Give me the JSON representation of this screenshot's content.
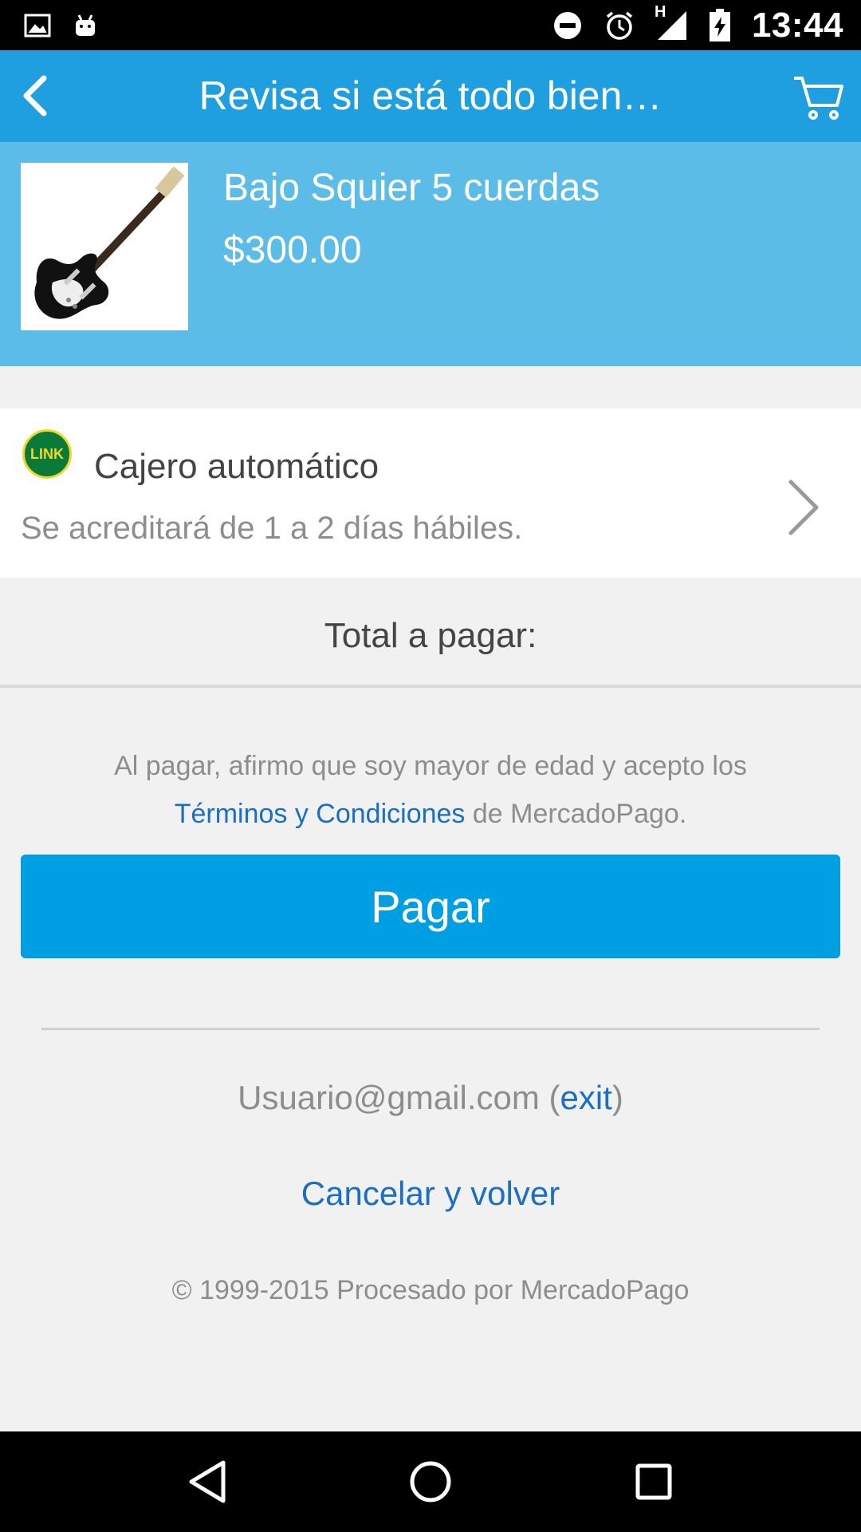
{
  "status_bar": {
    "time": "13:44",
    "left_icons": [
      "image-icon",
      "android-icon"
    ],
    "right_icons": [
      "do-not-disturb-icon",
      "alarm-icon",
      "signal-icon",
      "battery-charging-icon"
    ],
    "network_label": "H"
  },
  "toolbar": {
    "title": "Revisa si está todo bien…",
    "back_icon": "back-arrow-icon",
    "cart_icon": "cart-icon"
  },
  "product": {
    "name": "Bajo Squier 5 cuerdas",
    "price": "$300.00",
    "image_icon": "bass-guitar-image"
  },
  "payment_method": {
    "logo_text": "LINK",
    "label": "Cajero automático",
    "subtitle": "Se acreditará de 1 a 2 días hábiles."
  },
  "total": {
    "label": "Total a pagar:"
  },
  "terms": {
    "prefix": "Al pagar, afirmo que soy mayor de edad y acepto los",
    "link": "Términos y Condiciones",
    "suffix": " de MercadoPago."
  },
  "pay_button": {
    "label": "Pagar"
  },
  "user": {
    "email": "Usuario@gmail.com",
    "open_paren": " (",
    "exit": "exit",
    "close_paren": ")"
  },
  "cancel": {
    "label": "Cancelar y volver"
  },
  "footer": {
    "text": "© 1999-2015 Procesado por MercadoPago"
  },
  "colors": {
    "toolbar": "#1f9ee0",
    "product_header": "#5bbde7",
    "pay_button": "#009ee3",
    "link": "#1a6fc4"
  }
}
